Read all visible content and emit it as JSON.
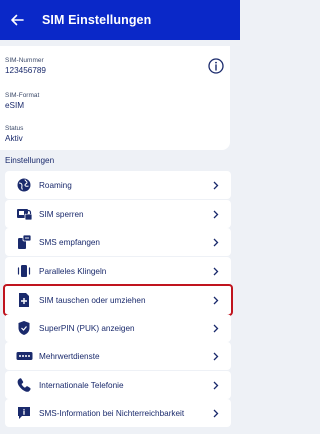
{
  "header": {
    "title": "SIM Einstellungen"
  },
  "sim_info": {
    "number_label": "SIM-Nummer",
    "number_value": "123456789",
    "format_label": "SIM-Format",
    "format_value": "eSIM",
    "status_label": "Status",
    "status_value": "Aktiv"
  },
  "settings": {
    "title": "Einstellungen",
    "items": [
      {
        "label": "Roaming",
        "icon": "globe-icon"
      },
      {
        "label": "SIM sperren",
        "icon": "sim-lock-icon"
      },
      {
        "label": "SMS empfangen",
        "icon": "sms-phone-icon"
      },
      {
        "label": "Paralleles Klingeln",
        "icon": "vibrating-phone-icon"
      },
      {
        "label": "SIM tauschen oder umziehen",
        "icon": "sim-add-icon",
        "highlighted": true
      },
      {
        "label": "SuperPIN (PUK) anzeigen",
        "icon": "shield-icon"
      },
      {
        "label": "Mehrwertdienste",
        "icon": "keypad-icon"
      },
      {
        "label": "Internationale Telefonie",
        "icon": "phone-icon"
      },
      {
        "label": "SMS-Information bei Nichterreichbarkeit",
        "icon": "message-info-icon"
      }
    ]
  },
  "colors": {
    "header": "#0a28c8",
    "text": "#1a2a6c",
    "highlight": "#c0141e",
    "background": "#eef1f6"
  }
}
